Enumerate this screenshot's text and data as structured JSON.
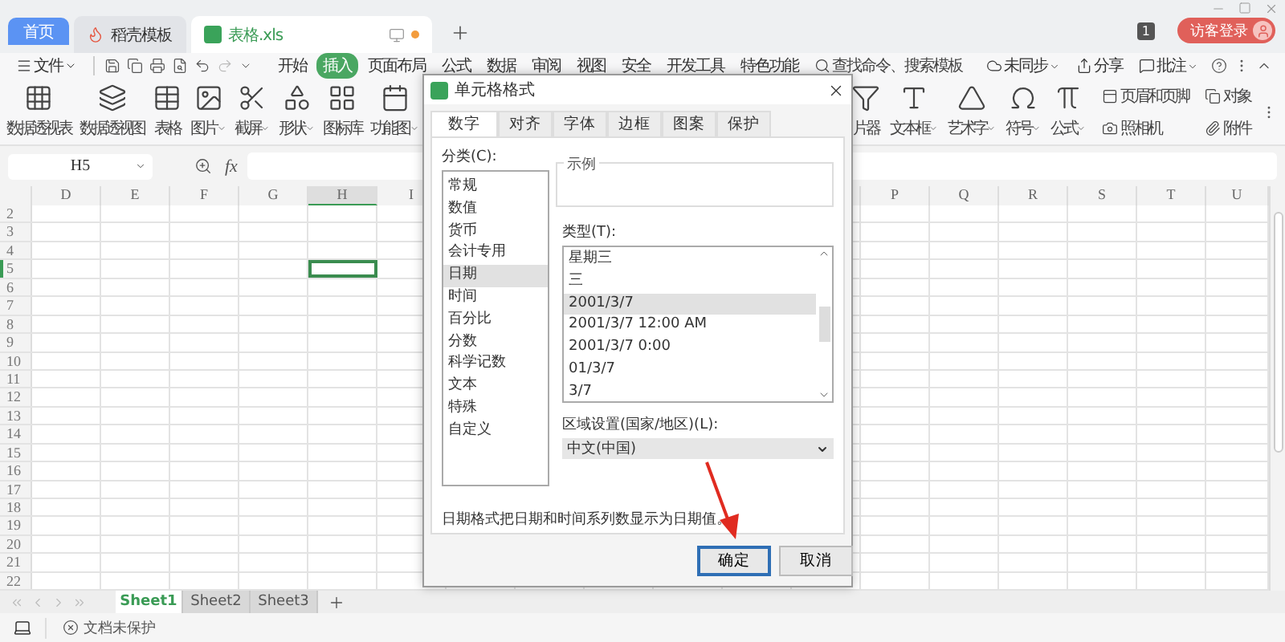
{
  "tabs": [
    {
      "label": "首页",
      "kind": "home",
      "selected": false
    },
    {
      "label": "稻壳模板",
      "kind": "docer",
      "selected": false
    },
    {
      "label": "表格.xls",
      "kind": "sheet",
      "selected": true
    }
  ],
  "title_bar": {
    "badge": "1",
    "login": "访客登录"
  },
  "menu": {
    "file": "文件",
    "items": [
      {
        "label": "开始",
        "selected": false
      },
      {
        "label": "插入",
        "selected": true
      },
      {
        "label": "页面布局",
        "selected": false
      },
      {
        "label": "公式",
        "selected": false
      },
      {
        "label": "数据",
        "selected": false
      },
      {
        "label": "审阅",
        "selected": false
      },
      {
        "label": "视图",
        "selected": false
      },
      {
        "label": "安全",
        "selected": false
      },
      {
        "label": "开发工具",
        "selected": false
      },
      {
        "label": "特色功能",
        "selected": false
      }
    ],
    "search": {
      "placeholder": "查找命令、搜索模板"
    },
    "actions": [
      {
        "label": "未同步",
        "dropdown": true
      },
      {
        "label": "分享",
        "dropdown": false
      },
      {
        "label": "批注",
        "dropdown": true
      }
    ]
  },
  "ribbon_left": [
    {
      "label": "数据透视表",
      "dropdown": false
    },
    {
      "label": "数据透视图",
      "dropdown": false
    },
    {
      "label": "表格",
      "dropdown": false
    },
    {
      "label": "图片",
      "dropdown": true
    },
    {
      "label": "截屏",
      "dropdown": true
    },
    {
      "label": "形状",
      "dropdown": true
    },
    {
      "label": "图标库",
      "dropdown": false
    },
    {
      "label": "功能图",
      "dropdown": true
    }
  ],
  "ribbon_right": [
    {
      "label": "片器",
      "dropdown": false
    },
    {
      "label": "文本框",
      "dropdown": true
    },
    {
      "label": "艺术字",
      "dropdown": true
    },
    {
      "label": "符号",
      "dropdown": true
    },
    {
      "label": "公式",
      "dropdown": true
    }
  ],
  "ribbon_small": [
    {
      "label": "页眉和页脚"
    },
    {
      "label": "照相机"
    },
    {
      "label": "对象"
    },
    {
      "label": "附件"
    }
  ],
  "formula_bar": {
    "name_box": "H5",
    "fx": "fx"
  },
  "sheet": {
    "columns_left": [
      {
        "label": "D",
        "selected": false
      },
      {
        "label": "E",
        "selected": false
      },
      {
        "label": "F",
        "selected": false
      },
      {
        "label": "G",
        "selected": false
      },
      {
        "label": "H",
        "selected": true
      },
      {
        "label": "I",
        "selected": false
      }
    ],
    "columns_right": [
      {
        "label": "P",
        "selected": false
      },
      {
        "label": "Q",
        "selected": false
      },
      {
        "label": "R",
        "selected": false
      },
      {
        "label": "S",
        "selected": false
      },
      {
        "label": "T",
        "selected": false
      },
      {
        "label": "U",
        "selected": false
      }
    ],
    "rows": [
      {
        "label": "2",
        "selected": false
      },
      {
        "label": "3",
        "selected": false
      },
      {
        "label": "4",
        "selected": false
      },
      {
        "label": "5",
        "selected": true
      },
      {
        "label": "6",
        "selected": false
      },
      {
        "label": "7",
        "selected": false
      },
      {
        "label": "8",
        "selected": false
      },
      {
        "label": "9",
        "selected": false
      },
      {
        "label": "10",
        "selected": false
      },
      {
        "label": "11",
        "selected": false
      },
      {
        "label": "12",
        "selected": false
      },
      {
        "label": "13",
        "selected": false
      },
      {
        "label": "14",
        "selected": false
      },
      {
        "label": "15",
        "selected": false
      },
      {
        "label": "16",
        "selected": false
      },
      {
        "label": "17",
        "selected": false
      },
      {
        "label": "18",
        "selected": false
      },
      {
        "label": "19",
        "selected": false
      },
      {
        "label": "20",
        "selected": false
      },
      {
        "label": "21",
        "selected": false
      },
      {
        "label": "22",
        "selected": false
      }
    ]
  },
  "sheet_tabs": [
    {
      "label": "Sheet1",
      "selected": true
    },
    {
      "label": "Sheet2",
      "selected": false
    },
    {
      "label": "Sheet3",
      "selected": false
    }
  ],
  "status_bar": {
    "protection": "文档未保护"
  },
  "dialog": {
    "title": "单元格格式",
    "tabs": [
      {
        "label": "数字",
        "selected": true
      },
      {
        "label": "对齐",
        "selected": false
      },
      {
        "label": "字体",
        "selected": false
      },
      {
        "label": "边框",
        "selected": false
      },
      {
        "label": "图案",
        "selected": false
      },
      {
        "label": "保护",
        "selected": false
      }
    ],
    "category_label": "分类(C):",
    "categories": [
      {
        "label": "常规",
        "selected": false
      },
      {
        "label": "数值",
        "selected": false
      },
      {
        "label": "货币",
        "selected": false
      },
      {
        "label": "会计专用",
        "selected": false
      },
      {
        "label": "日期",
        "selected": true
      },
      {
        "label": "时间",
        "selected": false
      },
      {
        "label": "百分比",
        "selected": false
      },
      {
        "label": "分数",
        "selected": false
      },
      {
        "label": "科学记数",
        "selected": false
      },
      {
        "label": "文本",
        "selected": false
      },
      {
        "label": "特殊",
        "selected": false
      },
      {
        "label": "自定义",
        "selected": false
      }
    ],
    "sample_label": "示例",
    "type_label": "类型(T):",
    "types": [
      {
        "label": "星期三",
        "selected": false
      },
      {
        "label": "三",
        "selected": false
      },
      {
        "label": "2001/3/7",
        "selected": true
      },
      {
        "label": "2001/3/7 12:00 AM",
        "selected": false
      },
      {
        "label": "2001/3/7 0:00",
        "selected": false
      },
      {
        "label": "01/3/7",
        "selected": false
      },
      {
        "label": "3/7",
        "selected": false
      }
    ],
    "locale_label": "区域设置(国家/地区)(L):",
    "locale": "中文(中国)",
    "description": "日期格式把日期和时间系列数显示为日期值。",
    "buttons": [
      {
        "label": "确定",
        "focused": true
      },
      {
        "label": "取消",
        "focused": false
      }
    ]
  }
}
